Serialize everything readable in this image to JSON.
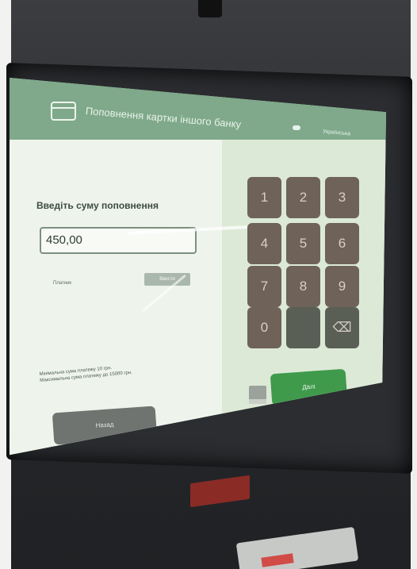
{
  "header": {
    "title": "Поповнення картки іншого банку",
    "icon": "card-icon",
    "language": "Українська"
  },
  "form": {
    "prompt": "Введіть суму поповнення",
    "amount_value": "450,00",
    "payer_label": "Платник",
    "enter_button": "Ввести"
  },
  "keypad": {
    "keys": [
      "1",
      "2",
      "3",
      "4",
      "5",
      "6",
      "7",
      "8",
      "9",
      "0",
      "",
      "⌫"
    ]
  },
  "limits": {
    "min_text": "Мінімальна сума платежу 10 грн.",
    "max_text": "Максимальна сума платежу до 15000 грн."
  },
  "footer": {
    "back_button": "Назад",
    "next_button": "Далі"
  },
  "colors": {
    "header_green": "#7fa98a",
    "next_green": "#3f9a4c",
    "key_brown": "#6e6259"
  }
}
